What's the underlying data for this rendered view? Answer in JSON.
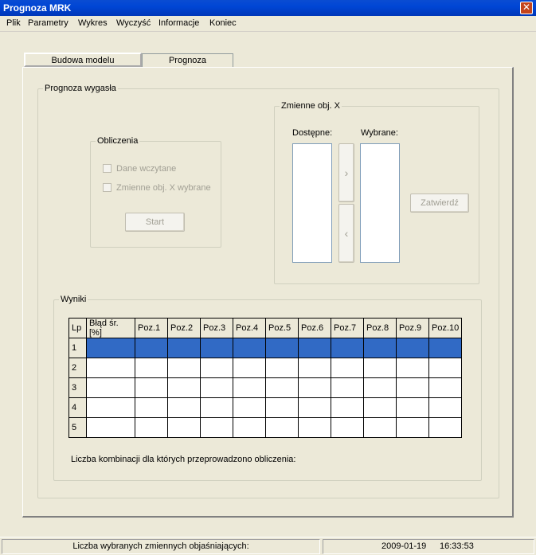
{
  "window": {
    "title": "Prognoza MRK",
    "close_glyph": "✕"
  },
  "menu": {
    "items": [
      "Plik",
      "Parametry",
      "Wykres",
      "Wyczyść",
      "Informacje",
      "Koniec"
    ]
  },
  "tabs": {
    "items": [
      "Budowa modelu",
      "Prognoza"
    ],
    "active": "Budowa modelu"
  },
  "prognoza_group": {
    "title": "Prognoza wygasła"
  },
  "obliczenia": {
    "title": "Obliczenia",
    "check_data_loaded": "Dane wczytane",
    "check_vars_selected": "Zmienne obj. X wybrane",
    "start_label": "Start"
  },
  "zmienne": {
    "title": "Zmienne obj. X",
    "available_label": "Dostępne:",
    "selected_label": "Wybrane:",
    "move_right": "›",
    "move_left": "‹",
    "confirm_label": "Zatwierdź"
  },
  "wyniki": {
    "title": "Wyniki",
    "columns": [
      "Lp",
      "Błąd śr. [%]",
      "Poz.1",
      "Poz.2",
      "Poz.3",
      "Poz.4",
      "Poz.5",
      "Poz.6",
      "Poz.7",
      "Poz.8",
      "Poz.9",
      "Poz.10"
    ],
    "rows": [
      "1",
      "2",
      "3",
      "4",
      "5"
    ],
    "selected_row": "1",
    "combinations_label": "Liczba kombinacji dla których przeprowadzono obliczenia:"
  },
  "status": {
    "selected_vars_label": "Liczba wybranych zmiennych objaśniających:",
    "date": "2009-01-19",
    "time": "16:33:53"
  },
  "colors": {
    "selection": "#316ac5",
    "titlebar": "#0046d5",
    "face": "#ece9d8"
  }
}
